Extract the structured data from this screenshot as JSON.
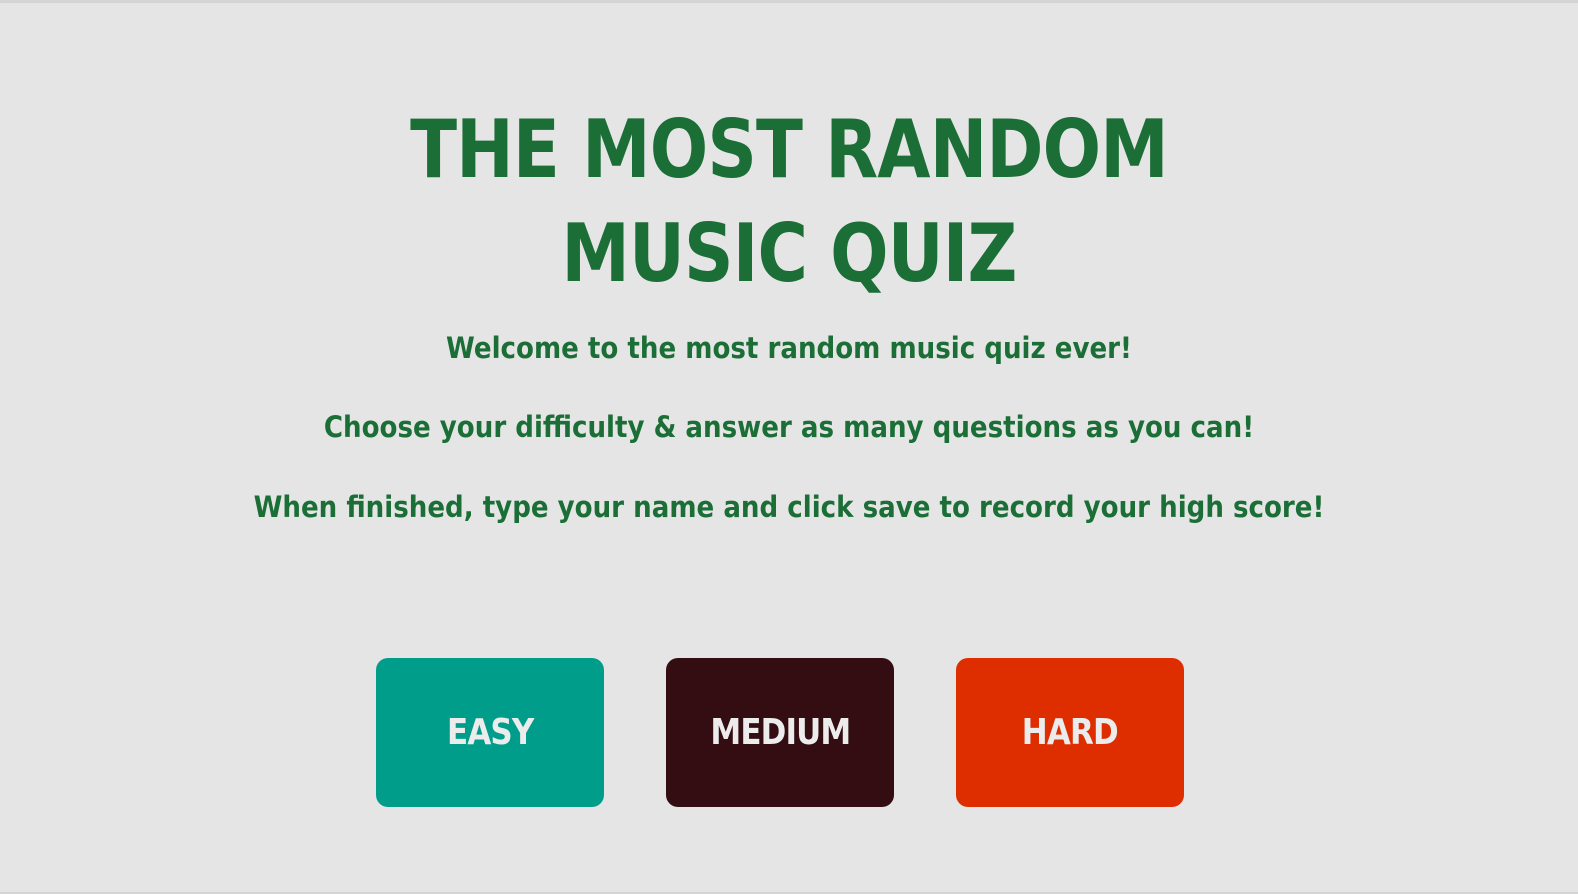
{
  "colors": {
    "background": "#e5e5e5",
    "heading": "#1b6e36",
    "easy": "#009e8a",
    "medium": "#330d12",
    "hard": "#de2e00",
    "button_text": "#ececec"
  },
  "header": {
    "title_line_1": "THE MOST RANDOM",
    "title_line_2": "MUSIC QUIZ"
  },
  "intro": {
    "line_1": "Welcome to the most random music quiz ever!",
    "line_2": "Choose your difficulty & answer as many questions as you can!",
    "line_3": "When finished, type your name and click save to record your high score!"
  },
  "difficulty": {
    "easy_label": "EASY",
    "medium_label": "MEDIUM",
    "hard_label": "HARD"
  }
}
